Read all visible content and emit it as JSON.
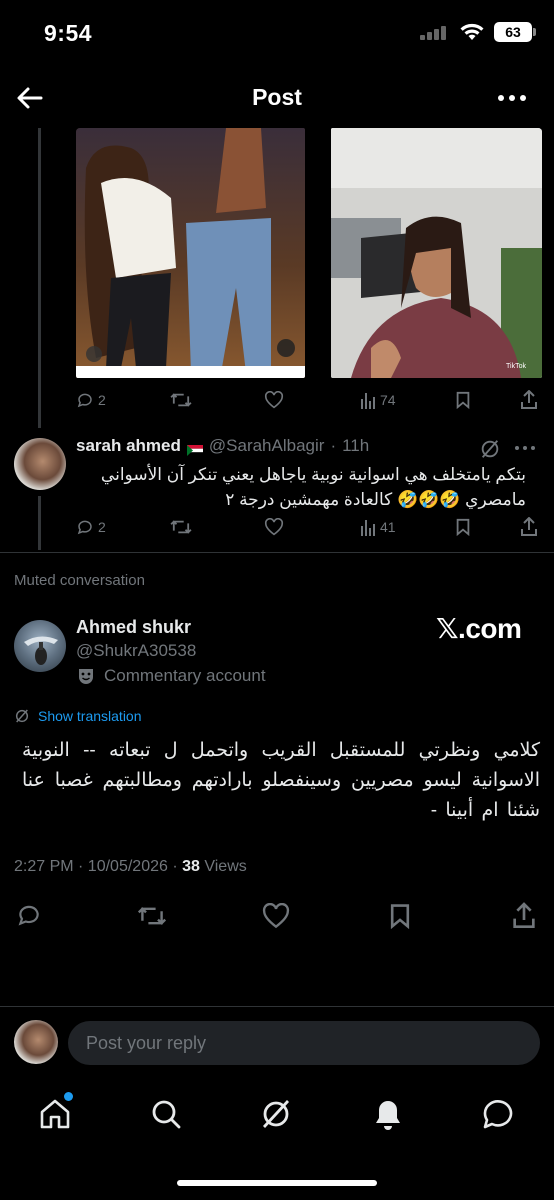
{
  "status": {
    "time": "9:54",
    "battery": "63"
  },
  "header": {
    "title": "Post"
  },
  "media_post": {
    "actions": {
      "replies": "2",
      "reposts": "",
      "likes": "",
      "views": "74"
    },
    "video_badge": "TikTok"
  },
  "reply": {
    "name": "sarah ahmed",
    "handle": "@SarahAlbagir",
    "time": "11h",
    "text": "بتكم يامتخلف هي اسوانية نوبية ياجاهل يعني تنكر آن الأسواني مامصري 🤣🤣🤣 كالعادة مهمشين درجة ٢",
    "actions": {
      "replies": "2",
      "views": "41"
    }
  },
  "muted_label": "Muted conversation",
  "main_post": {
    "name": "Ahmed shukr",
    "handle": "@ShukrA30538",
    "account_label": "Commentary account",
    "watermark": "𝕏.com",
    "translate_label": "Show translation",
    "text": "كلامي  ونظرتي للمستقبل القريب واتحمل ل تبعاته -- النوبية الاسوانية ليسو مصريين  وسينفصلو بارادتهم ومطالبتهم  غصبا عنا  شئنا ام أبينا -",
    "meta_time": "2:27 PM · 10/05/2026 · ",
    "views_count": "38",
    "views_label": " Views"
  },
  "reply_bar": {
    "placeholder": "Post your reply"
  },
  "colors": {
    "accent": "#1d9bf0",
    "muted": "#71767b",
    "background": "#000000"
  }
}
